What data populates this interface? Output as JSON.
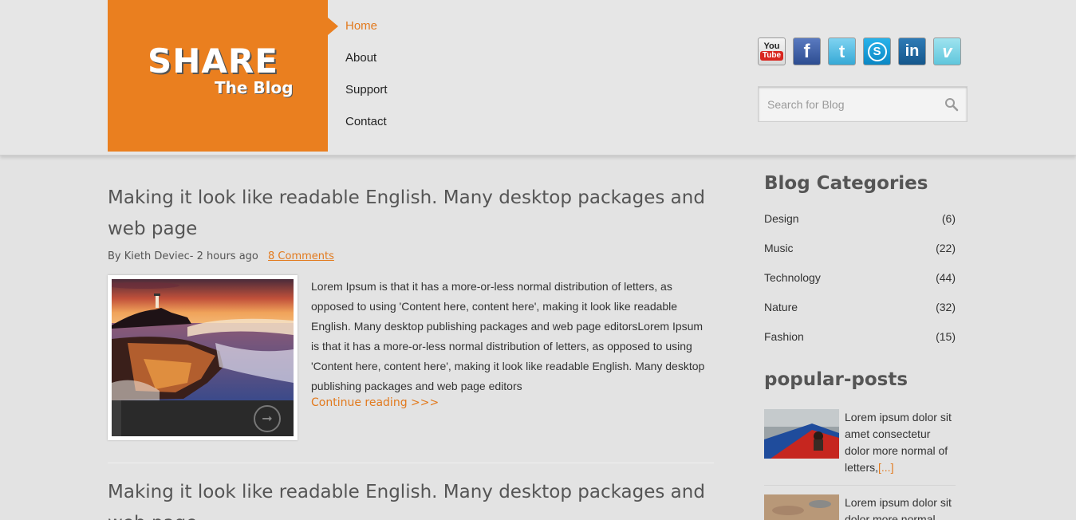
{
  "logo": {
    "title": "SHARE",
    "subtitle": "The Blog"
  },
  "nav": {
    "items": [
      {
        "label": "Home",
        "active": true
      },
      {
        "label": "About",
        "active": false
      },
      {
        "label": "Support",
        "active": false
      },
      {
        "label": "Contact",
        "active": false
      }
    ]
  },
  "socials": [
    {
      "name": "youtube-icon",
      "text_top": "You",
      "text_bottom": "Tube"
    },
    {
      "name": "facebook-icon",
      "text": "f"
    },
    {
      "name": "twitter-icon",
      "text": "t"
    },
    {
      "name": "skype-icon",
      "text": "S"
    },
    {
      "name": "linkedin-icon",
      "text": "in"
    },
    {
      "name": "vimeo-icon",
      "text": "v"
    }
  ],
  "search": {
    "placeholder": "Search for Blog"
  },
  "posts": [
    {
      "title": "Making it look like readable English. Many desktop packages and web page",
      "author_time": "By Kieth Deviec- 2 hours ago",
      "comments": "8 Comments",
      "excerpt": "Lorem Ipsum is that it has a more-or-less normal distribution of letters, as opposed to using 'Content here, content here', making it look like readable English. Many desktop publishing packages and web page editorsLorem Ipsum is that it has a more-or-less normal distribution of letters, as opposed to using 'Content here, content here', making it look like readable English. Many desktop publishing packages and web page editors",
      "read_more": "Continue reading >>>"
    },
    {
      "title": "Making it look like readable English. Many desktop packages and web page"
    }
  ],
  "sidebar": {
    "categories_heading": "Blog Categories",
    "categories": [
      {
        "name": "Design",
        "count": "(6)"
      },
      {
        "name": "Music",
        "count": "(22)"
      },
      {
        "name": "Technology",
        "count": "(44)"
      },
      {
        "name": "Nature",
        "count": "(32)"
      },
      {
        "name": "Fashion",
        "count": "(15)"
      }
    ],
    "popular_heading": "popular-posts",
    "popular": [
      {
        "text": "Lorem ipsum dolor sit amet consectetur dolor more normal of letters,",
        "more": "[...]"
      },
      {
        "text": "Lorem ipsum dolor sit dolor more normal",
        "more": ""
      }
    ]
  },
  "colors": {
    "accent": "#ea7f1f",
    "link": "#e27a1e",
    "background": "#e3e3e3"
  }
}
